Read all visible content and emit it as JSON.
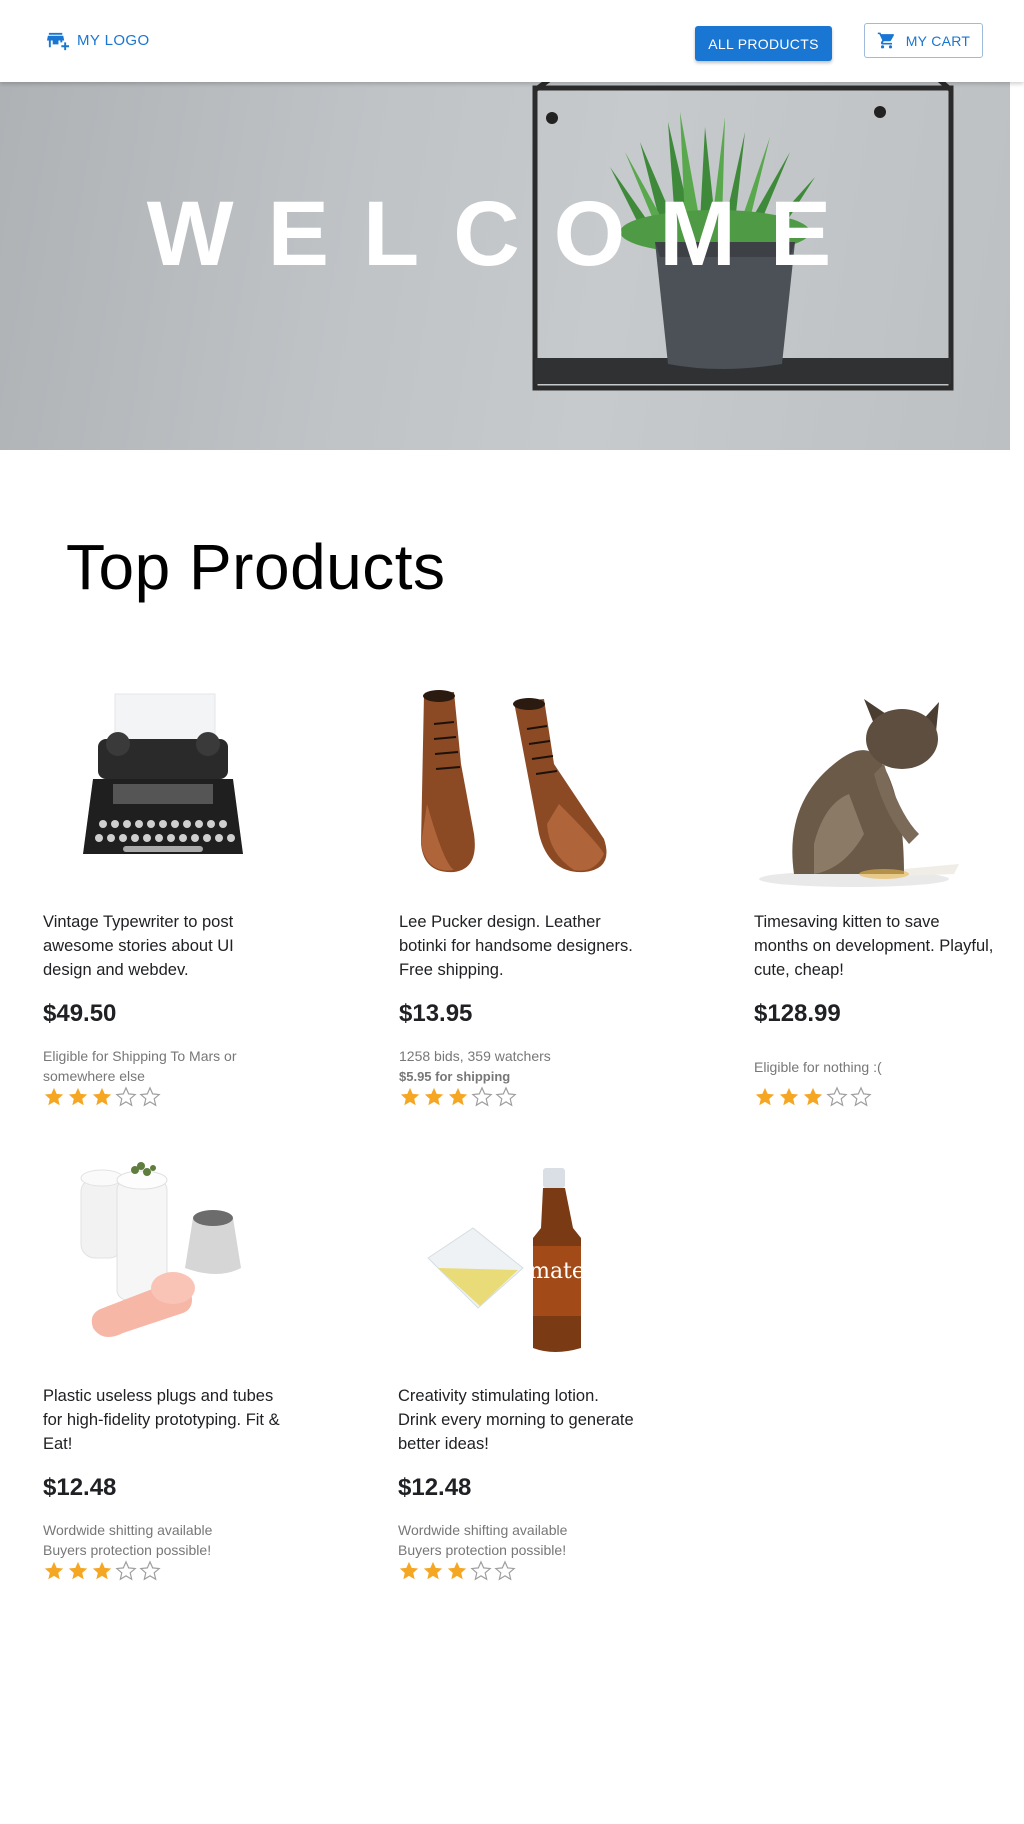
{
  "header": {
    "logo_label": "MY LOGO",
    "all_products_label": "ALL PRODUCTS",
    "cart_label": "MY CART"
  },
  "hero": {
    "title": "WELCOME"
  },
  "section": {
    "title": "Top Products"
  },
  "products": [
    {
      "title": "Vintage Typewriter to post awesome stories about UI design and webdev.",
      "price": "$49.50",
      "note1": "Eligible for Shipping To Mars or somewhere else",
      "note2": "",
      "rating": 3,
      "rating_max": 5
    },
    {
      "title": "Lee Pucker design. Leather botinki for handsome designers. Free shipping.",
      "price": "$13.95",
      "note1": "1258 bids, 359 watchers",
      "note2": "$5.95 for shipping",
      "rating": 3,
      "rating_max": 5
    },
    {
      "title": "Timesaving kitten to save months on development. Playful, cute, cheap!",
      "price": "$128.99",
      "note1": "Eligible for nothing :(",
      "note2": "",
      "rating": 3,
      "rating_max": 5
    },
    {
      "title": "Plastic useless plugs and tubes for high-fidelity prototyping. Fit & Eat!",
      "price": "$12.48",
      "note1": "Wordwide shitting available",
      "note2": "Buyers protection possible!",
      "rating": 3,
      "rating_max": 5
    },
    {
      "title": "Creativity stimulating lotion. Drink every morning to generate better ideas!",
      "price": "$12.48",
      "note1": "Wordwide shifting available",
      "note2": "Buyers protection possible!",
      "rating": 3,
      "rating_max": 5
    }
  ],
  "images": {
    "bottle_label": "mate"
  },
  "colors": {
    "primary": "#1976d2",
    "star_filled": "#f5a623",
    "star_empty": "#9e9e9e",
    "muted_text": "#777777"
  }
}
